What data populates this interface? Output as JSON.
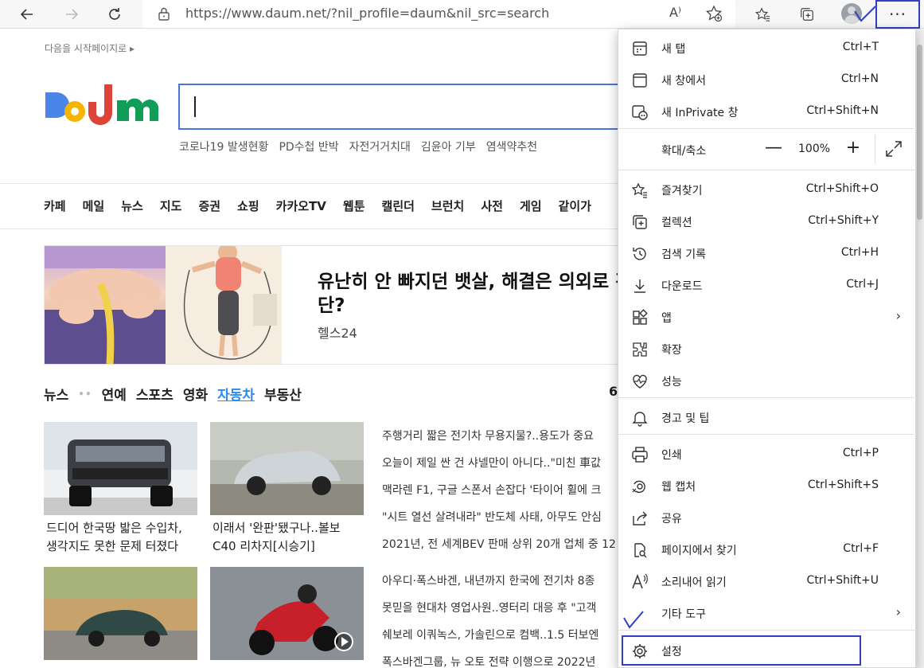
{
  "browser": {
    "url": "https://www.daum.net/?nil_profile=daum&nil_src=search",
    "read_aloud_label": "A⁾",
    "more_label": "···"
  },
  "page": {
    "start_page_link": "다음을 시작페이지로 ▸",
    "hot_keywords": [
      "코로나19 발생현황",
      "PD수첩 반박",
      "자전거거치대",
      "김윤아 기부",
      "염색약추천"
    ],
    "gnb": [
      "카페",
      "메일",
      "뉴스",
      "지도",
      "증권",
      "쇼핑",
      "카카오TV",
      "웹툰",
      "캘린더",
      "브런치",
      "사전",
      "게임",
      "같이가"
    ],
    "ad": {
      "title": "유난히 안 빠지던 뱃살, 해결은 의외로 간단?",
      "source": "헬스24"
    },
    "tabs": [
      "뉴스",
      "연예",
      "스포츠",
      "영화",
      "자동차",
      "부동산"
    ],
    "tab_dots": "••",
    "tab_right": "6",
    "cards": [
      {
        "caption_1": "드디어 한국땅 밟은 수입차,",
        "caption_2": "생각지도 못한 문제 터졌다"
      },
      {
        "caption_1": "이래서 '완판'됐구나..볼보",
        "caption_2": "C40 리차지[시승기]"
      }
    ],
    "headlines": [
      "주행거리 짧은 전기차 무용지물?..용도가 중요",
      "오늘이 제일 싼 건 샤넬만이 아니다..\"미친 車값",
      "맥라렌 F1, 구글 스폰서 손잡다 '타이어 휠에 크",
      "\"시트 열선 살려내라\" 반도체 사태, 아무도 안심",
      "2021년, 전 세계BEV 판매 상위 20개 업체 중 12",
      "아우디·폭스바겐, 내년까지 한국에 전기차 8종",
      "못믿을 현대차 영업사원..영터리 대응 후 \"고객",
      "쉐보레 이쿼녹스, 가솔린으로 컴백..1.5 터보엔",
      "폭스바겐그룹, 뉴 오토 전략 이행으로 2022년"
    ]
  },
  "menu": {
    "items": [
      {
        "label": "새 탭",
        "shortcut": "Ctrl+T"
      },
      {
        "label": "새 창에서",
        "shortcut": "Ctrl+N"
      },
      {
        "label": "새 InPrivate 창",
        "shortcut": "Ctrl+Shift+N"
      },
      {
        "label": "즐겨찾기",
        "shortcut": "Ctrl+Shift+O"
      },
      {
        "label": "컬렉션",
        "shortcut": "Ctrl+Shift+Y"
      },
      {
        "label": "검색 기록",
        "shortcut": "Ctrl+H"
      },
      {
        "label": "다운로드",
        "shortcut": "Ctrl+J"
      },
      {
        "label": "앱",
        "shortcut": ""
      },
      {
        "label": "확장",
        "shortcut": ""
      },
      {
        "label": "성능",
        "shortcut": ""
      },
      {
        "label": "경고 및 팁",
        "shortcut": ""
      },
      {
        "label": "인쇄",
        "shortcut": "Ctrl+P"
      },
      {
        "label": "웹 캡처",
        "shortcut": "Ctrl+Shift+S"
      },
      {
        "label": "공유",
        "shortcut": ""
      },
      {
        "label": "페이지에서 찾기",
        "shortcut": "Ctrl+F"
      },
      {
        "label": "소리내어 읽기",
        "shortcut": "Ctrl+Shift+U"
      },
      {
        "label": "기타 도구",
        "shortcut": ""
      },
      {
        "label": "설정",
        "shortcut": ""
      }
    ],
    "zoom": {
      "label": "확대/축소",
      "value": "100%",
      "minus": "—",
      "plus": "+"
    },
    "submenu_arrow": "›"
  },
  "colors": {
    "accent": "#2a8cf0",
    "highlight_box": "#3040c0",
    "search_border": "#4a74e0"
  }
}
